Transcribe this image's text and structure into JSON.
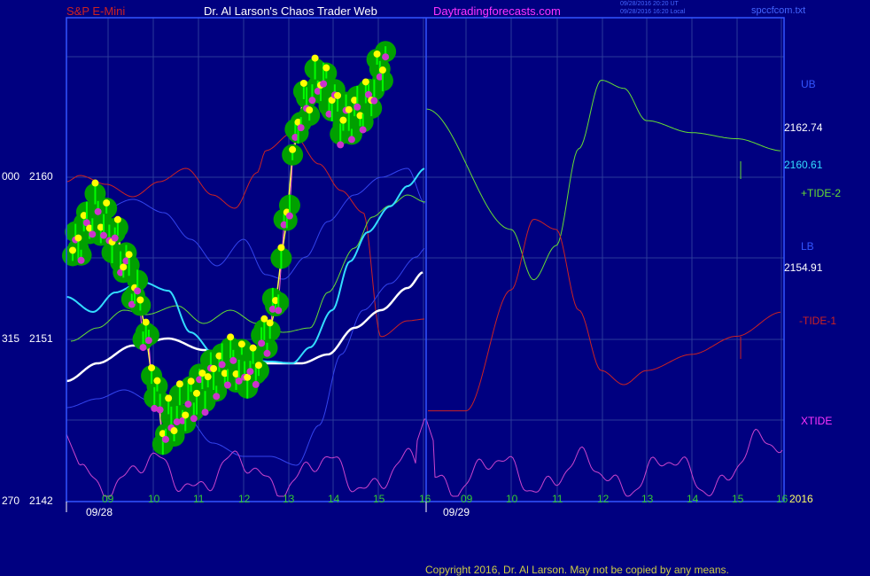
{
  "header": {
    "instrument": "S&P E-Mini",
    "author": "Dr. Al Larson's Chaos Trader Web",
    "site": "Daytradingforecasts.com",
    "ut_line": "09/28/2016 20:20 UT",
    "local_line": "09/28/2016 16:20 Local",
    "filename": "spccfcom.txt"
  },
  "y_axis": {
    "labels": [
      {
        "left": "000",
        "price": "2160"
      },
      {
        "left": "315",
        "price": "2151"
      },
      {
        "left": "270",
        "price": "2142"
      }
    ]
  },
  "x_axis": {
    "day1_hours": [
      "09",
      "10",
      "11",
      "12",
      "13",
      "14",
      "15",
      "16"
    ],
    "day2_hours": [
      "09",
      "10",
      "11",
      "12",
      "13",
      "14",
      "15",
      "16"
    ],
    "date1": "09/28",
    "date2": "09/29",
    "year": "2016"
  },
  "right_panel": {
    "ub": "UB",
    "ub_value": "2162.74",
    "tide2_value": "2160.61",
    "tide2_label": "+TIDE-2",
    "lb": "LB",
    "lb_value": "2154.91",
    "tide1_label": "-TIDE-1",
    "xtide_label": "XTIDE"
  },
  "footer": {
    "copyright": "Copyright 2016, Dr. Al Larson. May not be copied by any means."
  },
  "colors": {
    "background": "#000080",
    "grid": "#2a3a9a",
    "frame": "#3355ff",
    "price_bar": "#00ff00",
    "halo": "#00a000",
    "high_marker": "#ffff00",
    "low_marker": "#cc33cc",
    "upper_band": "#cc2222",
    "tide2": "#66dd33",
    "tide1": "#cc2222",
    "xtide": "#cc44cc",
    "cyan_avg": "#33ddff",
    "white_avg": "#ffffff",
    "yellow_avg": "#ffff44",
    "blue_band": "#3344ee"
  },
  "chart_data": {
    "type": "line",
    "title": "S&P E-Mini",
    "ylim": [
      2142,
      2166
    ],
    "y_ticks": [
      2142,
      2151,
      2160
    ],
    "x_categories": [
      "09/28 09",
      "10",
      "11",
      "12",
      "13",
      "14",
      "15",
      "16",
      "09/29 09",
      "10",
      "11",
      "12",
      "13",
      "14",
      "15",
      "16"
    ],
    "price_bars_0928": {
      "hours": [
        9.0,
        9.5,
        10.0,
        10.5,
        11.0,
        11.5,
        12.0,
        12.5,
        13.0,
        13.5,
        14.0,
        14.5,
        15.0,
        15.5,
        16.0
      ],
      "close": [
        2154.2,
        2156.5,
        2154.8,
        2151.7,
        2145.6,
        2146.7,
        2148.0,
        2148.9,
        2148.4,
        2151.6,
        2161.0,
        2163.1,
        2160.8,
        2161.6,
        2164.5
      ]
    },
    "series": [
      {
        "name": "UB",
        "last_value": 2162.74
      },
      {
        "name": "+TIDE-2",
        "last_value": 2160.61
      },
      {
        "name": "LB",
        "last_value": 2154.91
      },
      {
        "name": "-TIDE-1"
      },
      {
        "name": "XTIDE"
      }
    ],
    "forecast_0929": {
      "tide2_hours": [
        9.0,
        10.0,
        10.5,
        11.0,
        11.5,
        12.0,
        12.5,
        13.0,
        14.0,
        15.0,
        16.0
      ],
      "tide2_price": [
        2163.7,
        2155.5,
        2153.0,
        2154.7,
        2159.5,
        2162.9,
        2162.5,
        2160.9,
        2160.3,
        2160.0,
        2159.4
      ],
      "tide1_hours": [
        9.0,
        10.0,
        10.5,
        11.0,
        11.5,
        12.0,
        12.5,
        13.0,
        14.0,
        15.0,
        16.0
      ],
      "tide1_price": [
        2146.5,
        2152.5,
        2156.0,
        2155.5,
        2151.5,
        2148.5,
        2147.8,
        2148.5,
        2149.3,
        2150.2,
        2151.4
      ]
    },
    "grid": true
  }
}
